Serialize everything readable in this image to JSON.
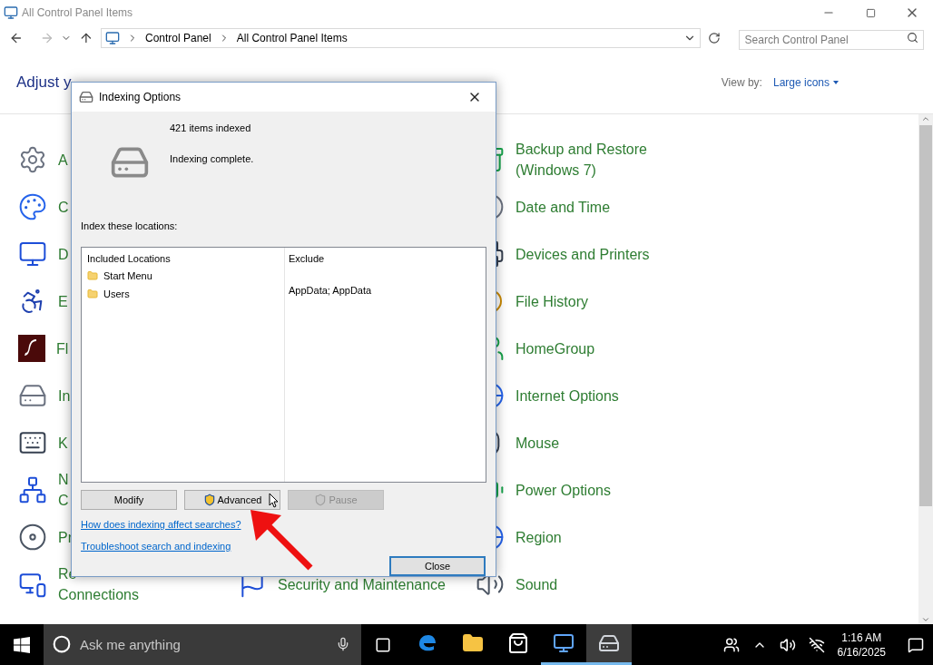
{
  "window": {
    "title": "All Control Panel Items"
  },
  "nav": {
    "breadcrumb": [
      "Control Panel",
      "All Control Panel Items"
    ],
    "search": {
      "placeholder": "Search Control Panel"
    }
  },
  "header": {
    "title": "Adjust y",
    "view_by_label": "View by:",
    "view_by_value": "Large icons"
  },
  "columns": [
    [
      {
        "lines": [
          "A"
        ]
      },
      {
        "lines": [
          "C"
        ]
      },
      {
        "lines": [
          "D"
        ]
      },
      {
        "lines": [
          "E"
        ]
      },
      {
        "lines": [
          "Fl"
        ]
      },
      {
        "lines": [
          "In"
        ]
      },
      {
        "lines": [
          "K"
        ]
      },
      {
        "lines": [
          "N",
          "C"
        ]
      },
      {
        "lines": [
          "Pr"
        ]
      },
      {
        "lines": [
          "Re",
          "Connections"
        ]
      }
    ],
    [
      {
        "lines": [
          "Security and Maintenance"
        ]
      }
    ],
    [
      {
        "lines": [
          "Backup and Restore",
          "(Windows 7)"
        ]
      },
      {
        "lines": [
          "Date and Time"
        ]
      },
      {
        "lines": [
          "Devices and Printers"
        ]
      },
      {
        "lines": [
          "File History"
        ]
      },
      {
        "lines": [
          "HomeGroup"
        ]
      },
      {
        "lines": [
          "Internet Options"
        ]
      },
      {
        "lines": [
          "Mouse"
        ]
      },
      {
        "lines": [
          "Power Options"
        ]
      },
      {
        "lines": [
          "Region"
        ]
      },
      {
        "lines": [
          "Sound"
        ]
      }
    ]
  ],
  "dialog": {
    "title": "Indexing Options",
    "items_indexed": "421 items indexed",
    "status": "Indexing complete.",
    "locations_label": "Index these locations:",
    "columns": [
      "Included Locations",
      "Exclude"
    ],
    "rows": [
      {
        "location": "Start Menu"
      },
      {
        "location": "Users",
        "exclude": "AppData; AppData"
      }
    ],
    "buttons": [
      {
        "label": "Modify",
        "disabled": false,
        "shield": false
      },
      {
        "label": "Advanced",
        "disabled": false,
        "shield": true
      },
      {
        "label": "Pause",
        "disabled": true,
        "shield": true
      }
    ],
    "links": [
      "How does indexing affect searches?",
      "Troubleshoot search and indexing"
    ],
    "close_button": "Close"
  },
  "taskbar": {
    "search_placeholder": "Ask me anything",
    "apps": [
      {
        "running": false,
        "selected": false
      },
      {
        "running": false,
        "selected": false
      },
      {
        "running": false,
        "selected": false
      },
      {
        "running": true,
        "selected": false
      },
      {
        "running": true,
        "selected": true
      }
    ],
    "time": "1:16 AM",
    "date": "6/16/2025"
  }
}
